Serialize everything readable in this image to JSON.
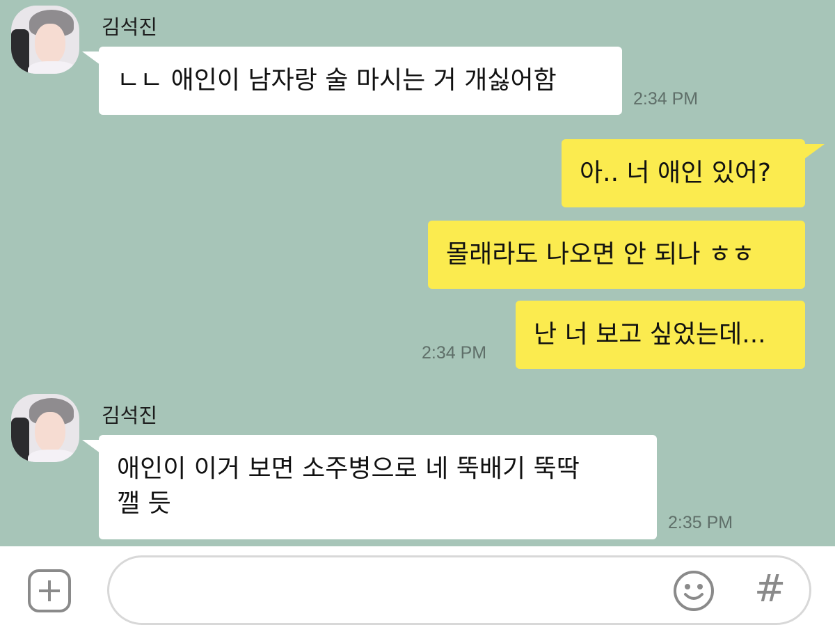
{
  "messages": [
    {
      "sender": "김석진",
      "text": "ㄴㄴ 애인이 남자랑 술 마시는 거 개싫어함",
      "time": "2:34 PM"
    },
    {
      "text": "아.. 너 애인 있어?"
    },
    {
      "text": "몰래라도 나오면 안 되나 ㅎㅎ"
    },
    {
      "text": "난 너 보고 싶었는데...",
      "time": "2:34 PM"
    },
    {
      "sender": "김석진",
      "lines": [
        "애인이 이거 보면 소주병으로 네 뚝배기 뚝딱",
        "깰 듯"
      ],
      "time": "2:35 PM"
    }
  ],
  "input": {
    "plus_icon": "plus-icon",
    "emoji_icon": "smiley-icon",
    "hash_icon": "hash-icon",
    "hash_glyph": "#"
  },
  "colors": {
    "chat_background": "#a7c5b8",
    "outgoing_bubble": "#fbeb4f",
    "incoming_bubble": "#ffffff"
  }
}
